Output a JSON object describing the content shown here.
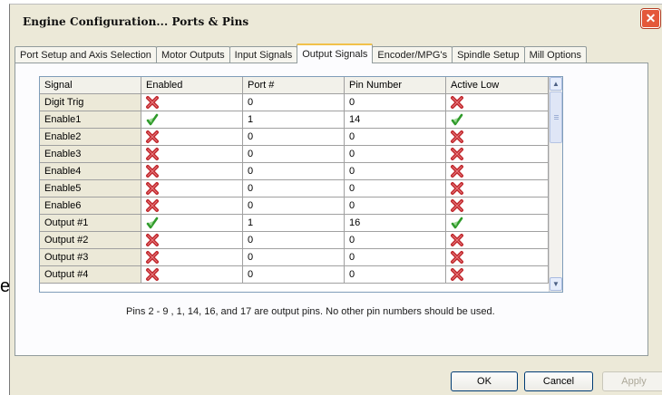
{
  "window": {
    "title": "Engine Configuration... Ports & Pins"
  },
  "tabs": [
    {
      "label": "Port Setup and Axis Selection",
      "active": false
    },
    {
      "label": "Motor Outputs",
      "active": false
    },
    {
      "label": "Input Signals",
      "active": false
    },
    {
      "label": "Output Signals",
      "active": true
    },
    {
      "label": "Encoder/MPG's",
      "active": false
    },
    {
      "label": "Spindle Setup",
      "active": false
    },
    {
      "label": "Mill Options",
      "active": false
    }
  ],
  "grid": {
    "columns": [
      "Signal",
      "Enabled",
      "Port #",
      "Pin Number",
      "Active Low"
    ],
    "rows": [
      {
        "signal": "Digit  Trig",
        "enabled": "x-icon",
        "port": "0",
        "pin": "0",
        "active_low": "x-icon"
      },
      {
        "signal": "Enable1",
        "enabled": "check-icon",
        "port": "1",
        "pin": "14",
        "active_low": "check-icon"
      },
      {
        "signal": "Enable2",
        "enabled": "x-icon",
        "port": "0",
        "pin": "0",
        "active_low": "x-icon"
      },
      {
        "signal": "Enable3",
        "enabled": "x-icon",
        "port": "0",
        "pin": "0",
        "active_low": "x-icon"
      },
      {
        "signal": "Enable4",
        "enabled": "x-icon",
        "port": "0",
        "pin": "0",
        "active_low": "x-icon"
      },
      {
        "signal": "Enable5",
        "enabled": "x-icon",
        "port": "0",
        "pin": "0",
        "active_low": "x-icon"
      },
      {
        "signal": "Enable6",
        "enabled": "x-icon",
        "port": "0",
        "pin": "0",
        "active_low": "x-icon"
      },
      {
        "signal": "Output #1",
        "enabled": "check-icon",
        "port": "1",
        "pin": "16",
        "active_low": "check-icon"
      },
      {
        "signal": "Output #2",
        "enabled": "x-icon",
        "port": "0",
        "pin": "0",
        "active_low": "x-icon"
      },
      {
        "signal": "Output #3",
        "enabled": "x-icon",
        "port": "0",
        "pin": "0",
        "active_low": "x-icon"
      },
      {
        "signal": "Output #4",
        "enabled": "x-icon",
        "port": "0",
        "pin": "0",
        "active_low": "x-icon"
      }
    ]
  },
  "note": "Pins 2 - 9 , 1, 14, 16, and 17 are output pins. No  other pin numbers should be used.",
  "buttons": {
    "ok": "OK",
    "cancel": "Cancel",
    "apply": "Apply"
  },
  "stray_text": "e",
  "colors": {
    "x_icon": "#c0282d",
    "check_icon": "#2f9a2a",
    "tab_highlight": "#f1c14a",
    "close_button": "#e4583a"
  }
}
